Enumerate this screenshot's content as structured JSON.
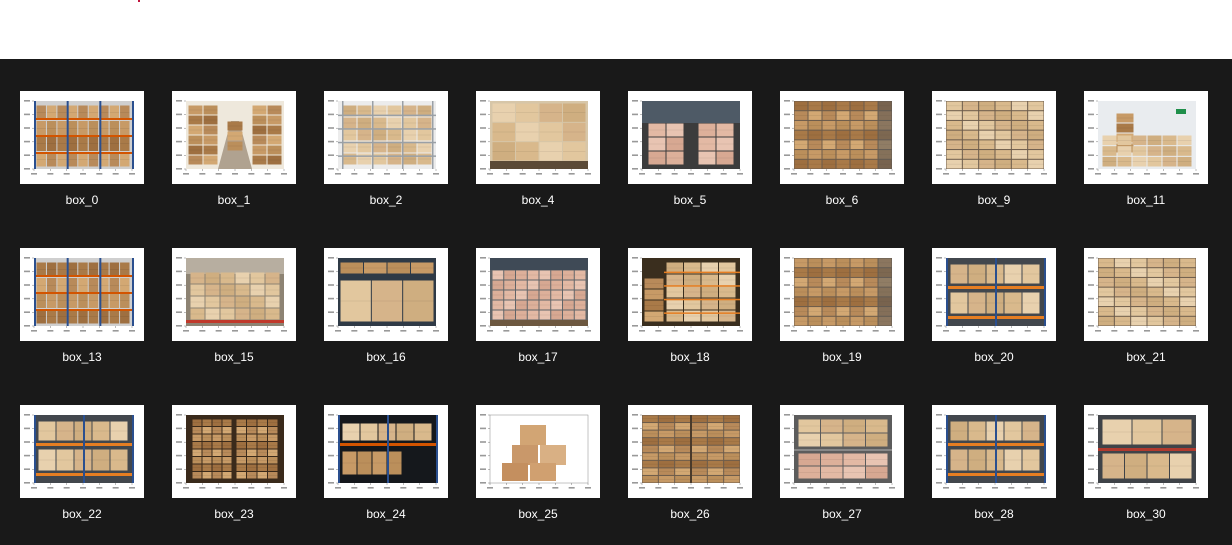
{
  "window": {
    "background": "#191919",
    "header_background": "#ffffff",
    "accent": "#c0143c"
  },
  "gallery": {
    "items": [
      {
        "label": "box_0",
        "scene": "shelves"
      },
      {
        "label": "box_1",
        "scene": "aisle"
      },
      {
        "label": "box_2",
        "scene": "wire-shelf"
      },
      {
        "label": "box_4",
        "scene": "pallet-stack"
      },
      {
        "label": "box_5",
        "scene": "warehouse-pallets"
      },
      {
        "label": "box_6",
        "scene": "wall-stack"
      },
      {
        "label": "box_9",
        "scene": "wall-stack-light"
      },
      {
        "label": "box_11",
        "scene": "room-stack"
      },
      {
        "label": "box_13",
        "scene": "shelves-dense"
      },
      {
        "label": "box_15",
        "scene": "floor-stack"
      },
      {
        "label": "box_16",
        "scene": "big-boxes"
      },
      {
        "label": "box_17",
        "scene": "pallet-rows"
      },
      {
        "label": "box_18",
        "scene": "shelves-lit"
      },
      {
        "label": "box_19",
        "scene": "wall-stack"
      },
      {
        "label": "box_20",
        "scene": "rack-two-level"
      },
      {
        "label": "box_21",
        "scene": "wall-stack-light"
      },
      {
        "label": "box_22",
        "scene": "rack-two-level"
      },
      {
        "label": "box_23",
        "scene": "dark-stack"
      },
      {
        "label": "box_24",
        "scene": "rack-dark"
      },
      {
        "label": "box_25",
        "scene": "box-pyramid"
      },
      {
        "label": "box_26",
        "scene": "container-stack"
      },
      {
        "label": "box_27",
        "scene": "rack-cluttered"
      },
      {
        "label": "box_28",
        "scene": "rack-two-level"
      },
      {
        "label": "box_30",
        "scene": "rack-large-boxes"
      }
    ]
  }
}
